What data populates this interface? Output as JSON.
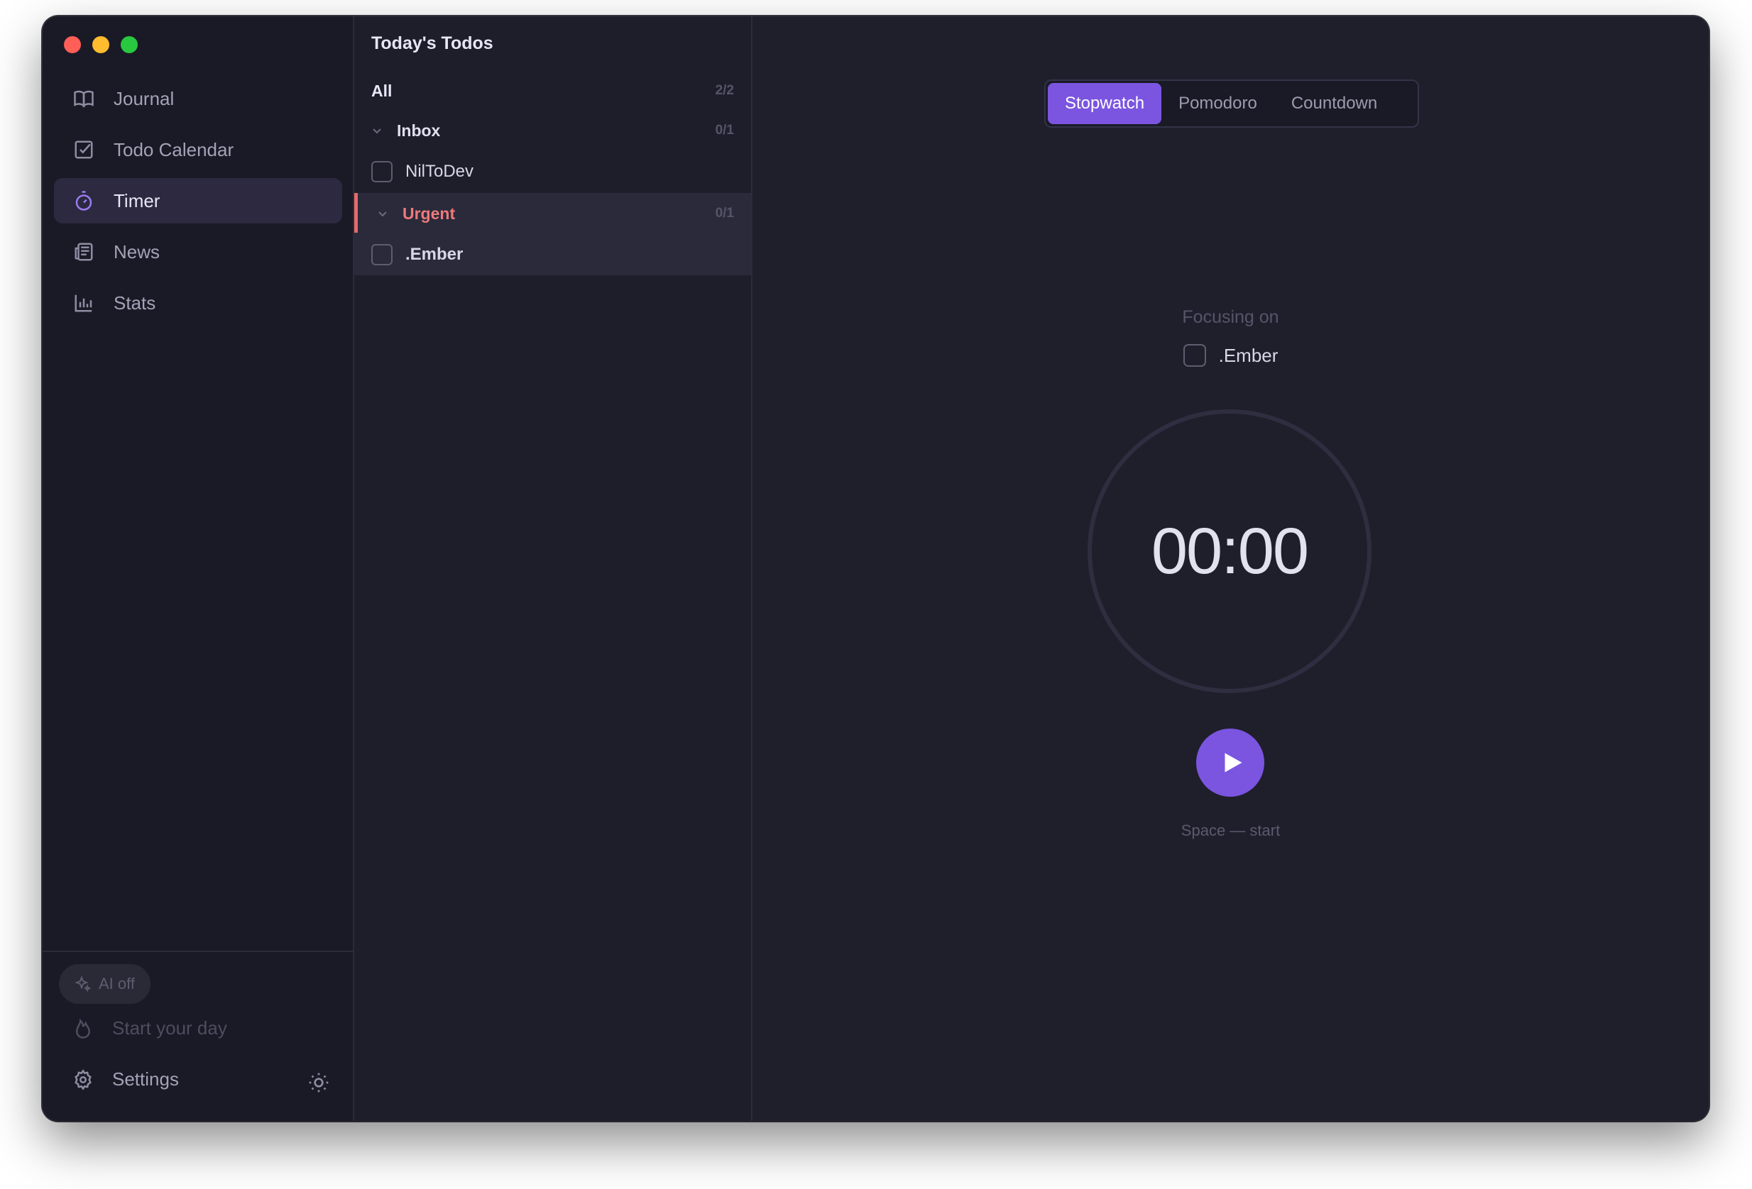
{
  "sidebar": {
    "items": [
      {
        "label": "Journal",
        "icon": "book-icon"
      },
      {
        "label": "Todo Calendar",
        "icon": "checkbox-icon"
      },
      {
        "label": "Timer",
        "icon": "stopwatch-icon",
        "active": true
      },
      {
        "label": "News",
        "icon": "newspaper-icon"
      },
      {
        "label": "Stats",
        "icon": "bar-chart-icon"
      }
    ],
    "ai_label": "AI off",
    "start_day_label": "Start your day",
    "settings_label": "Settings"
  },
  "todos": {
    "title": "Today's Todos",
    "all_label": "All",
    "all_count": "2/2",
    "groups": [
      {
        "name": "Inbox",
        "count": "0/1",
        "items": [
          "NilToDev"
        ]
      },
      {
        "name": "Urgent",
        "count": "0/1",
        "items": [
          ".Ember"
        ],
        "color": "#ee7a7a"
      }
    ]
  },
  "timer": {
    "modes": [
      "Stopwatch",
      "Pomodoro",
      "Countdown"
    ],
    "active_mode": "Stopwatch",
    "focusing_label": "Focusing on",
    "focus_task": ".Ember",
    "time": "00:00",
    "hint": "Space — start"
  },
  "colors": {
    "accent": "#7b55e0",
    "urgent": "#ee7a7a",
    "background": "#1f1f2c",
    "sidebar": "#1a1a26"
  }
}
